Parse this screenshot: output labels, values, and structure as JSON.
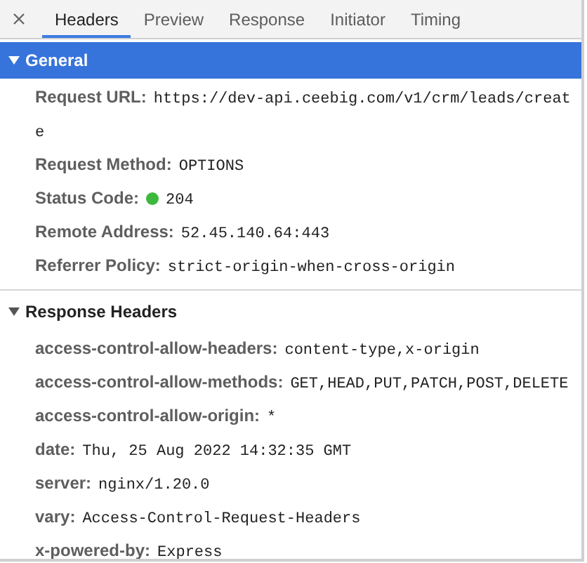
{
  "tabs": [
    {
      "label": "Headers",
      "selected": true
    },
    {
      "label": "Preview",
      "selected": false
    },
    {
      "label": "Response",
      "selected": false
    },
    {
      "label": "Initiator",
      "selected": false
    },
    {
      "label": "Timing",
      "selected": false
    }
  ],
  "sections": [
    {
      "title": "General",
      "expanded": true,
      "selected": true,
      "rows": [
        {
          "name": "Request URL:",
          "value": "https://dev-api.ceebig.com/v1/crm/leads/create"
        },
        {
          "name": "Request Method:",
          "value": "OPTIONS"
        },
        {
          "name": "Status Code:",
          "value": "204",
          "color": "#3cb93c"
        },
        {
          "name": "Remote Address:",
          "value": "52.45.140.64:443"
        },
        {
          "name": "Referrer Policy:",
          "value": "strict-origin-when-cross-origin"
        }
      ]
    },
    {
      "title": "Response Headers",
      "expanded": true,
      "selected": false,
      "rows": [
        {
          "name": "access-control-allow-headers:",
          "value": "content-type,x-origin"
        },
        {
          "name": "access-control-allow-methods:",
          "value": "GET,HEAD,PUT,PATCH,POST,DELETE"
        },
        {
          "name": "access-control-allow-origin:",
          "value": "*"
        },
        {
          "name": "date:",
          "value": "Thu, 25 Aug 2022 14:32:35 GMT"
        },
        {
          "name": "server:",
          "value": "nginx/1.20.0"
        },
        {
          "name": "vary:",
          "value": "Access-Control-Request-Headers"
        },
        {
          "name": "x-powered-by:",
          "value": "Express"
        }
      ]
    }
  ]
}
